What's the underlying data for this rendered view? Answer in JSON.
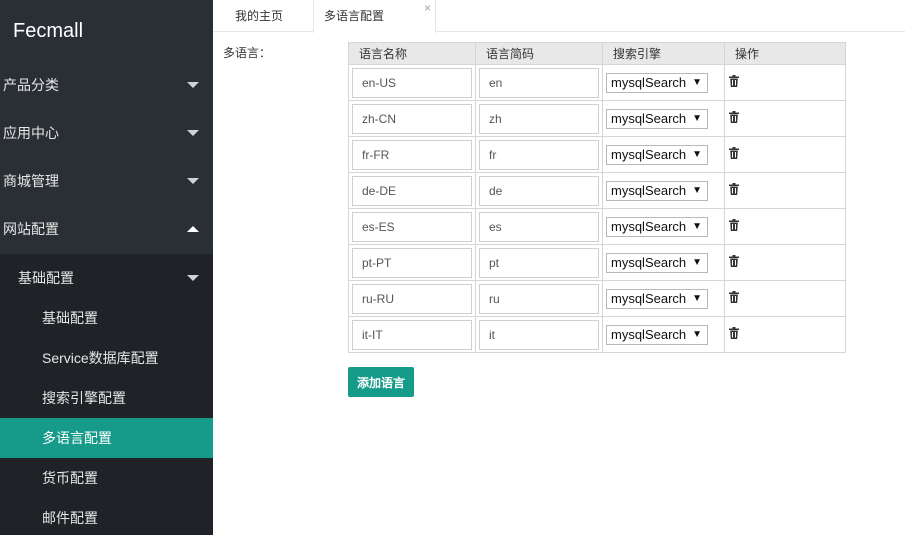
{
  "sidebar": {
    "logo": "Fecmall",
    "menu": [
      {
        "label": "产品分类"
      },
      {
        "label": "应用中心"
      },
      {
        "label": "商城管理"
      },
      {
        "label": "网站配置"
      }
    ],
    "submenu": {
      "label": "基础配置",
      "items": [
        {
          "label": "基础配置"
        },
        {
          "label": "Service数据库配置"
        },
        {
          "label": "搜索引擎配置"
        },
        {
          "label": "多语言配置"
        },
        {
          "label": "货币配置"
        },
        {
          "label": "邮件配置"
        }
      ]
    }
  },
  "tabs": [
    {
      "label": "我的主页"
    },
    {
      "label": "多语言配置",
      "close": "×"
    }
  ],
  "form": {
    "label": "多语言：",
    "columns": [
      "语言名称",
      "语言简码",
      "搜索引擎",
      "操作"
    ],
    "rows": [
      {
        "name": "en-US",
        "code": "en",
        "engine": "mysqlSearch"
      },
      {
        "name": "zh-CN",
        "code": "zh",
        "engine": "mysqlSearch"
      },
      {
        "name": "fr-FR",
        "code": "fr",
        "engine": "mysqlSearch"
      },
      {
        "name": "de-DE",
        "code": "de",
        "engine": "mysqlSearch"
      },
      {
        "name": "es-ES",
        "code": "es",
        "engine": "mysqlSearch"
      },
      {
        "name": "pt-PT",
        "code": "pt",
        "engine": "mysqlSearch"
      },
      {
        "name": "ru-RU",
        "code": "ru",
        "engine": "mysqlSearch"
      },
      {
        "name": "it-IT",
        "code": "it",
        "engine": "mysqlSearch"
      }
    ],
    "add_button": "添加语言"
  },
  "icons": {
    "row_action": "trash-icon",
    "select_arrow": "▼"
  },
  "colors": {
    "sidebar_bg": "#2a2f35",
    "active_item": "#169b8a",
    "accent_button": "#169b8a"
  }
}
